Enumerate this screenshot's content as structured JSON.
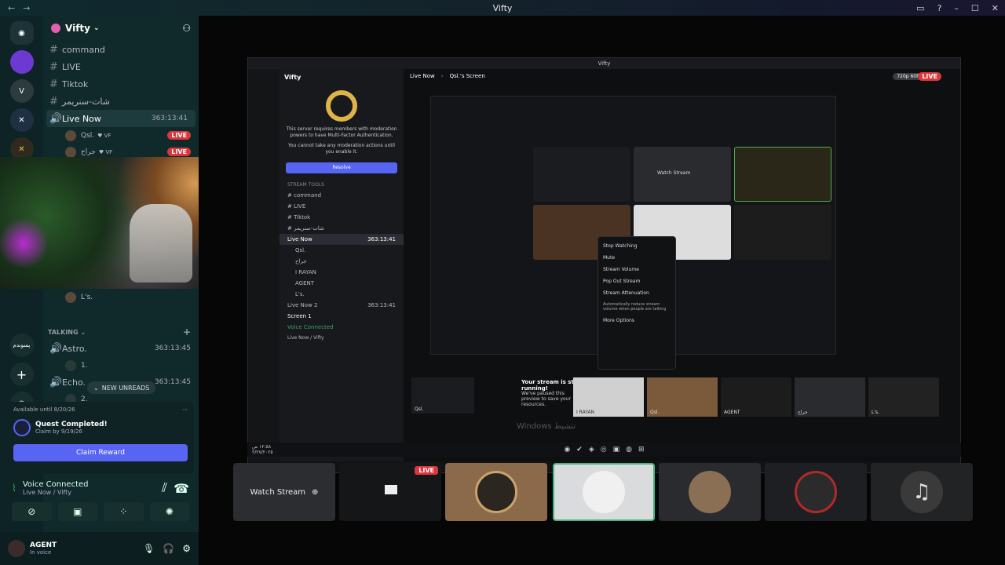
{
  "titlebar": {
    "title": "Vifty",
    "back": "←",
    "forward": "→",
    "ctrl_min": "–",
    "ctrl_max": "☐",
    "ctrl_close": "✕"
  },
  "guild": {
    "name": "Vifty"
  },
  "channels": [
    {
      "name": "command",
      "icon": "#"
    },
    {
      "name": "LIVE",
      "icon": "#"
    },
    {
      "name": "Tiktok",
      "icon": "#"
    },
    {
      "name": "شات-سنريمر",
      "icon": "#"
    }
  ],
  "live_channel": {
    "name": "Live Now",
    "time": "363:13:41"
  },
  "live_members": [
    {
      "name": "Qsl.",
      "tag": "VF",
      "badge": "LIVE"
    },
    {
      "name": "جراح",
      "tag": "VF",
      "badge": "LIVE"
    }
  ],
  "member_under_cam": "L's.",
  "rail_text": "پسوندم",
  "talking": {
    "category": "TALKING",
    "channels": [
      {
        "name": "Astro.",
        "time": "363:13:45",
        "sub": "1."
      },
      {
        "name": "Echo.",
        "time": "363:13:45",
        "sub": "2."
      }
    ],
    "unreads": "NEW UNREADS"
  },
  "quest": {
    "available": "Available until 8/20/26",
    "title": "Quest Completed!",
    "sub": "Claim by 9/19/26",
    "button": "Claim Reward"
  },
  "voice": {
    "title": "Voice Connected",
    "sub": "Live Now / Vifty"
  },
  "user": {
    "name": "AGENT",
    "status": "In voice"
  },
  "inner": {
    "title": "Vifty",
    "guild": "Vifty",
    "breadcrumb_channel": "Live Now",
    "breadcrumb_screen": "Qsl.'s Screen",
    "quality": "720p 60FPS",
    "live": "LIVE",
    "mfa_msg": "This server requires members with moderation powers to have Multi-Factor Authentication.",
    "mfa_msg2": "You cannot take any moderation actions until you enable it.",
    "resolve": "Resolve",
    "stream_tools": "STREAM TOOLS",
    "channels": [
      "command",
      "LIVE",
      "Tiktok",
      "شات-سنريمر"
    ],
    "live_channel": "Live Now",
    "live_time": "363:13:41",
    "members": [
      "Qsl.",
      "جراح",
      "I RAYAN",
      "AGENT",
      "L's."
    ],
    "live_now2": "Live Now 2",
    "live_now2_time": "363:13:41",
    "screen": "Screen 1",
    "voice": "Voice Connected",
    "voice_sub": "Live Now / Vifty",
    "context": [
      "Stop Watching",
      "Mute",
      "Stream Volume",
      "Pop Out Stream",
      "Stream Attenuation",
      "Automatically reduce stream volume when people are talking",
      "More Options"
    ],
    "watch": "Watch Stream",
    "paused_title": "Your stream is still running!",
    "paused_sub": "We've paused this preview to save your resources.",
    "tile_names": [
      "Qsl.",
      "I RAYAN",
      "Qsl.",
      "AGENT",
      "جراح",
      "L's."
    ],
    "clock": "١٢:٥٨ ص\n٢/٢٧/٢٠٢٥"
  },
  "windows_watermark": "Windows تنشيط",
  "strip": {
    "watch": "Watch Stream",
    "live": "LIVE"
  },
  "colors": {
    "accent": "#5865f2",
    "live": "#da373c",
    "sidebar": "#10292b",
    "rail": "#0e2326"
  }
}
